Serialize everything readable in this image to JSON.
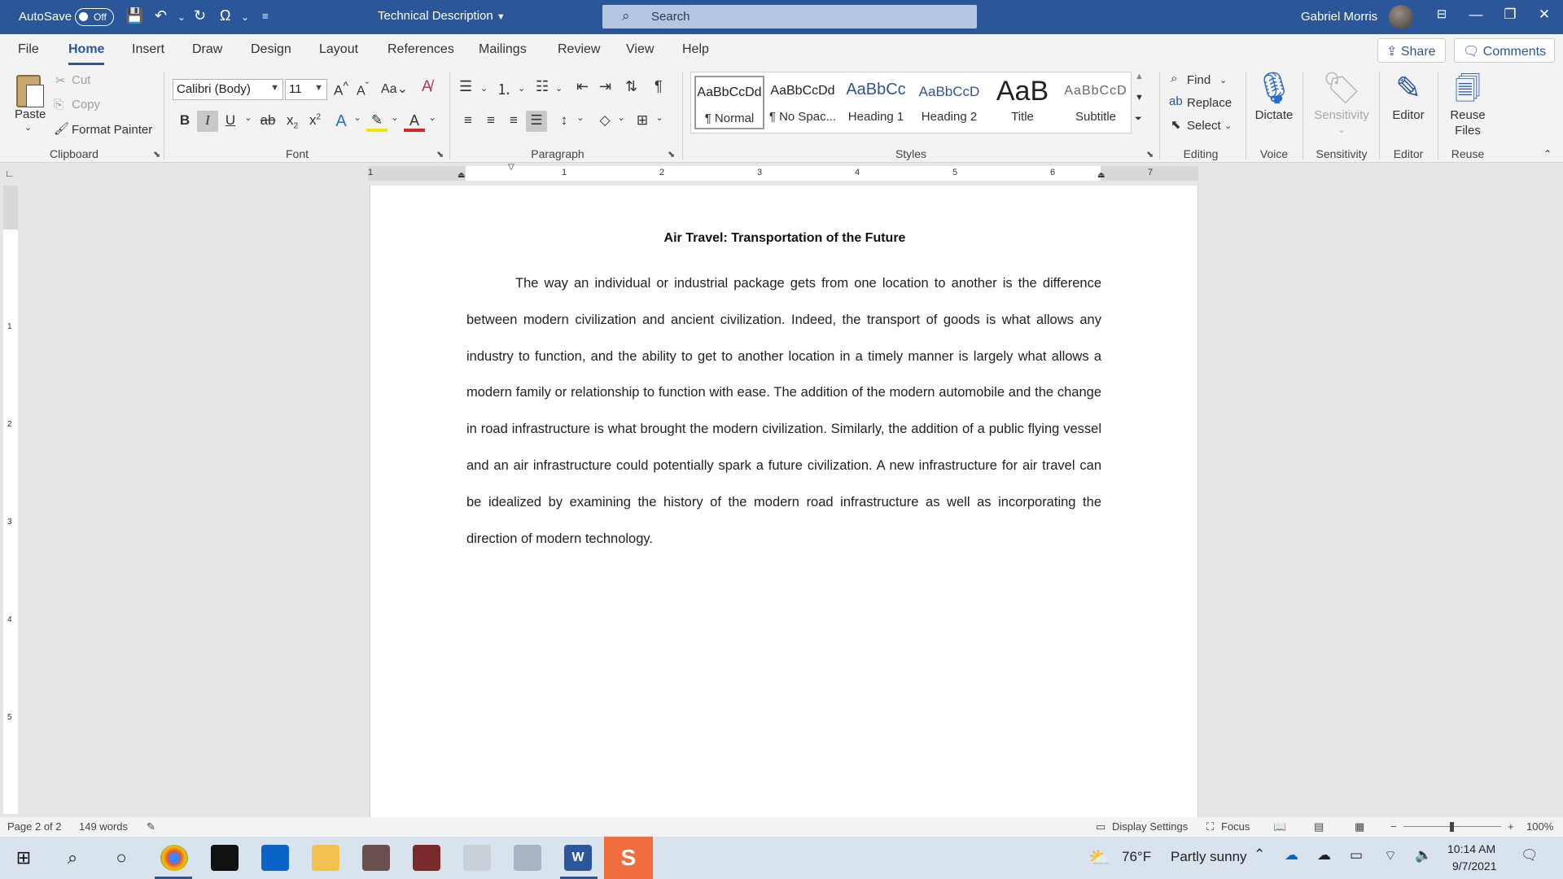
{
  "titlebar": {
    "autosave_label": "AutoSave",
    "autosave_state": "Off",
    "document_title": "Technical Description",
    "search_placeholder": "Search",
    "user_name": "Gabriel Morris"
  },
  "tabs": [
    "File",
    "Home",
    "Insert",
    "Draw",
    "Design",
    "Layout",
    "References",
    "Mailings",
    "Review",
    "View",
    "Help"
  ],
  "active_tab": "Home",
  "share_label": "Share",
  "comments_label": "Comments",
  "clipboard": {
    "paste": "Paste",
    "cut": "Cut",
    "copy": "Copy",
    "format_painter": "Format Painter",
    "group_label": "Clipboard"
  },
  "font": {
    "family": "Calibri (Body)",
    "size": "11",
    "group_label": "Font"
  },
  "paragraph": {
    "group_label": "Paragraph"
  },
  "styles": {
    "items": [
      {
        "preview": "AaBbCcDd",
        "name": "¶ Normal"
      },
      {
        "preview": "AaBbCcDd",
        "name": "¶ No Spac..."
      },
      {
        "preview": "AaBbCc",
        "name": "Heading 1"
      },
      {
        "preview": "AaBbCcD",
        "name": "Heading 2"
      },
      {
        "preview": "AaB",
        "name": "Title"
      },
      {
        "preview": "AaBbCcD",
        "name": "Subtitle"
      }
    ],
    "group_label": "Styles"
  },
  "editing": {
    "find": "Find",
    "replace": "Replace",
    "select": "Select",
    "group_label": "Editing"
  },
  "voice": {
    "dictate": "Dictate",
    "group_label": "Voice"
  },
  "sensitivity": {
    "button": "Sensitivity",
    "group_label": "Sensitivity"
  },
  "editor": {
    "button": "Editor",
    "group_label": "Editor"
  },
  "reuse": {
    "button_line1": "Reuse",
    "button_line2": "Files",
    "group_label": "Reuse Files"
  },
  "ruler": {
    "horizontal_numbers": [
      "1",
      "1",
      "2",
      "3",
      "4",
      "5",
      "6",
      "7"
    ],
    "vertical_numbers": [
      "1",
      "2",
      "3",
      "4",
      "5"
    ]
  },
  "document": {
    "heading": "Air Travel: Transportation of the Future",
    "body": "The way an individual or industrial package gets from one location to another is the difference between modern civilization and ancient civilization. Indeed, the transport of goods is what allows any industry to function, and the ability to get to another location in a timely manner is largely what allows a modern family or relationship to function with ease. The addition of the modern automobile and the change in road infrastructure is what brought the modern civilization. Similarly, the addition of a public flying vessel and an air infrastructure could potentially spark a future civilization. A new infrastructure for air travel can be idealized by examining the history of the modern road infrastructure as well as incorporating the direction of modern technology."
  },
  "statusbar": {
    "page": "Page 2 of 2",
    "words": "149 words",
    "display_settings": "Display Settings",
    "focus": "Focus",
    "zoom": "100%"
  },
  "taskbar": {
    "weather_temp": "76°F",
    "weather_text": "Partly sunny",
    "time": "10:14 AM",
    "date": "9/7/2021"
  },
  "colors": {
    "titlebar": "#2b579a",
    "accent": "#2b579a",
    "ribbon": "#f3f3f3",
    "canvas": "#e6e6e6"
  }
}
